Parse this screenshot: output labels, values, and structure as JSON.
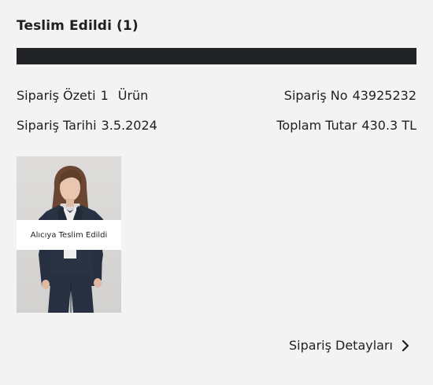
{
  "order": {
    "status_title": "Teslim Edildi (1)",
    "progress": 1.0,
    "summary_label": "Sipariş Özeti",
    "summary_count": "1",
    "summary_unit": "Ürün",
    "order_no_label": "Sipariş No",
    "order_no": "43925232",
    "date_label": "Sipariş Tarihi",
    "date": "3.5.2024",
    "total_label": "Toplam Tutar",
    "total": "430.3 TL"
  },
  "product": {
    "status_overlay": "Alıcıya Teslim Edildi"
  },
  "actions": {
    "details_label": "Sipariş Detayları",
    "details_icon": "chevron-right-icon"
  },
  "colors": {
    "background": "#f3f3f3",
    "progress_bar": "#222327",
    "text": "#1f1f22"
  }
}
